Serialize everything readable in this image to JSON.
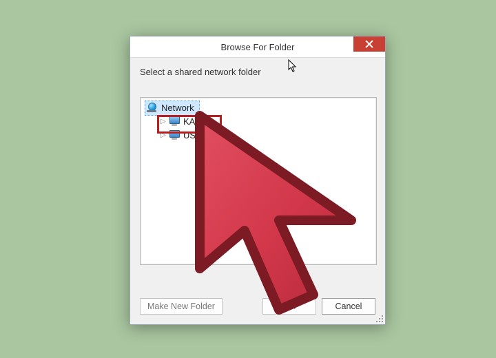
{
  "dialog": {
    "title": "Browse For Folder",
    "instruction": "Select a shared network folder"
  },
  "tree": {
    "root": {
      "label": "Network"
    },
    "items": [
      {
        "label": "KATE"
      },
      {
        "label": "USER-PC"
      }
    ]
  },
  "buttons": {
    "make_new_folder": "Make New Folder",
    "ok": "OK",
    "cancel": "Cancel"
  },
  "highlight": {
    "target_index": 0
  },
  "colors": {
    "background": "#a9c6a0",
    "close_button": "#c84034",
    "highlight_border": "#b41f1f",
    "cursor_fill": "#d2374a",
    "cursor_stroke": "#8a1f28"
  }
}
